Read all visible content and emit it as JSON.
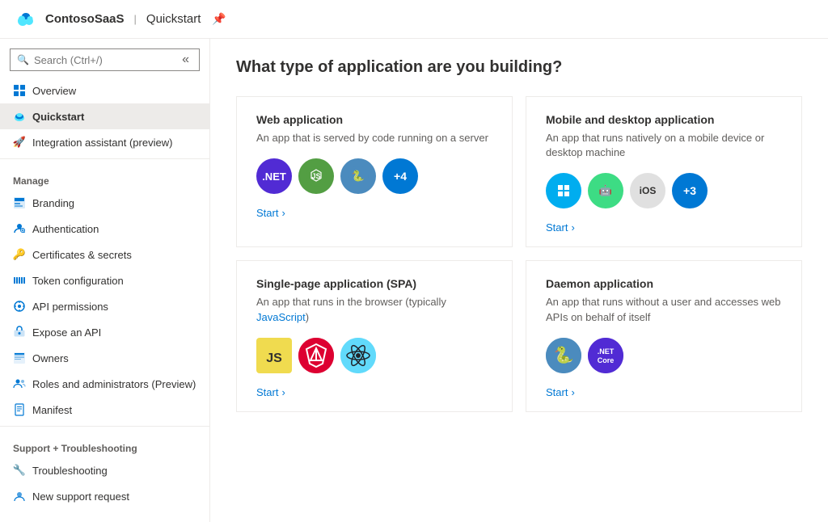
{
  "header": {
    "app_name": "ContosoSaaS",
    "separator": "|",
    "page": "Quickstart",
    "pin_symbol": "📌"
  },
  "sidebar": {
    "search_placeholder": "Search (Ctrl+/)",
    "nav_items": [
      {
        "id": "overview",
        "label": "Overview",
        "icon": "grid"
      },
      {
        "id": "quickstart",
        "label": "Quickstart",
        "icon": "cloud",
        "active": true
      },
      {
        "id": "integration",
        "label": "Integration assistant (preview)",
        "icon": "rocket"
      }
    ],
    "manage_label": "Manage",
    "manage_items": [
      {
        "id": "branding",
        "label": "Branding",
        "icon": "branding"
      },
      {
        "id": "authentication",
        "label": "Authentication",
        "icon": "auth"
      },
      {
        "id": "certificates",
        "label": "Certificates & secrets",
        "icon": "cert"
      },
      {
        "id": "token",
        "label": "Token configuration",
        "icon": "token"
      },
      {
        "id": "api-permissions",
        "label": "API permissions",
        "icon": "apiperm"
      },
      {
        "id": "expose-api",
        "label": "Expose an API",
        "icon": "exposeapi"
      },
      {
        "id": "owners",
        "label": "Owners",
        "icon": "owners"
      },
      {
        "id": "roles",
        "label": "Roles and administrators (Preview)",
        "icon": "roles"
      },
      {
        "id": "manifest",
        "label": "Manifest",
        "icon": "manifest"
      }
    ],
    "support_label": "Support + Troubleshooting",
    "support_items": [
      {
        "id": "troubleshooting",
        "label": "Troubleshooting",
        "icon": "trouble"
      },
      {
        "id": "new-support",
        "label": "New support request",
        "icon": "support"
      }
    ]
  },
  "content": {
    "page_title": "What type of application are you building?",
    "cards": [
      {
        "id": "web-app",
        "title": "Web application",
        "desc": "An app that is served by code running on a server",
        "start_label": "Start",
        "icons": [
          "dotnet",
          "node",
          "python",
          "plus4"
        ]
      },
      {
        "id": "mobile-desktop",
        "title": "Mobile and desktop application",
        "desc": "An app that runs natively on a mobile device or desktop machine",
        "start_label": "Start",
        "icons": [
          "windows",
          "android",
          "ios",
          "plus3"
        ]
      },
      {
        "id": "spa",
        "title": "Single-page application (SPA)",
        "desc": "An app that runs in the browser (typically JavaScript)",
        "start_label": "Start",
        "icons": [
          "js",
          "angular",
          "react"
        ]
      },
      {
        "id": "daemon",
        "title": "Daemon application",
        "desc": "An app that runs without a user and accesses web APIs on behalf of itself",
        "start_label": "Start",
        "icons": [
          "python2",
          "dotnetcore"
        ]
      }
    ]
  }
}
